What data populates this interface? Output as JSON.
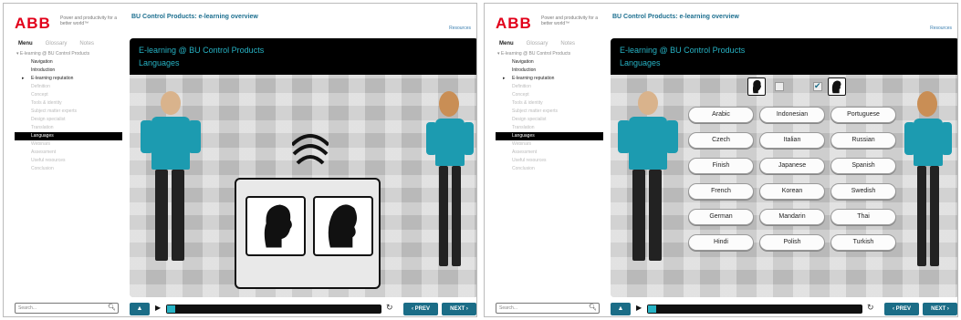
{
  "panels": [
    {
      "header": {
        "logo": "ABB",
        "tagline": "Power and productivity for a better world™",
        "title": "BU Control Products: e-learning overview",
        "resources": "Resources"
      },
      "tabs": [
        "Menu",
        "Glossary",
        "Notes"
      ],
      "course_root": "▾ E-learning @ BU Control Products",
      "menu": [
        {
          "label": "Navigation",
          "state": "done"
        },
        {
          "label": "Introduction",
          "state": "done"
        },
        {
          "label": "E-learning reputation",
          "state": "done-expand"
        },
        {
          "label": "Definition",
          "state": "todo"
        },
        {
          "label": "Concept",
          "state": "todo"
        },
        {
          "label": "Tools & identity",
          "state": "todo"
        },
        {
          "label": "Subject matter experts",
          "state": "todo"
        },
        {
          "label": "Design specialist",
          "state": "todo"
        },
        {
          "label": "Translation",
          "state": "todo"
        },
        {
          "label": "Languages",
          "state": "selected"
        },
        {
          "label": "Webinars",
          "state": "todo"
        },
        {
          "label": "Assessment",
          "state": "todo"
        },
        {
          "label": "Useful resources",
          "state": "todo"
        },
        {
          "label": "Conclusion",
          "state": "todo"
        }
      ],
      "search_placeholder": "Search...",
      "stage": {
        "title": "E-learning @ BU Control Products",
        "subtitle": "Languages"
      },
      "controls": {
        "prev": "‹ PREV",
        "next": "NEXT ›",
        "progress": 0.04
      }
    },
    {
      "header": {
        "logo": "ABB",
        "tagline": "Power and productivity for a better world™",
        "title": "BU Control Products: e-learning overview",
        "resources": "Resources"
      },
      "tabs": [
        "Menu",
        "Glossary",
        "Notes"
      ],
      "course_root": "▾ E-learning @ BU Control Products",
      "menu": [
        {
          "label": "Navigation",
          "state": "done"
        },
        {
          "label": "Introduction",
          "state": "done"
        },
        {
          "label": "E-learning reputation",
          "state": "done-expand"
        },
        {
          "label": "Definition",
          "state": "todo"
        },
        {
          "label": "Concept",
          "state": "todo"
        },
        {
          "label": "Tools & identity",
          "state": "todo"
        },
        {
          "label": "Subject matter experts",
          "state": "todo"
        },
        {
          "label": "Design specialist",
          "state": "todo"
        },
        {
          "label": "Translation",
          "state": "todo"
        },
        {
          "label": "Languages",
          "state": "selected"
        },
        {
          "label": "Webinars",
          "state": "todo"
        },
        {
          "label": "Assessment",
          "state": "todo"
        },
        {
          "label": "Useful resources",
          "state": "todo"
        },
        {
          "label": "Conclusion",
          "state": "todo"
        }
      ],
      "search_placeholder": "Search...",
      "stage": {
        "title": "E-learning @ BU Control Products",
        "subtitle": "Languages",
        "male_checked": false,
        "female_checked": true,
        "languages": [
          "Arabic",
          "Indonesian",
          "Portuguese",
          "Czech",
          "Italian",
          "Russian",
          "Finish",
          "Japanese",
          "Spanish",
          "French",
          "Korean",
          "Swedish",
          "German",
          "Mandarin",
          "Thai",
          "Hindi",
          "Polish",
          "Turkish"
        ]
      },
      "controls": {
        "prev": "‹ PREV",
        "next": "NEXT ›",
        "progress": 0.04
      }
    }
  ],
  "icons": {
    "volume": "volume-icon",
    "play": "play-icon",
    "replay": "replay-icon",
    "search": "search-icon",
    "sound_waves": "sound-waves-icon"
  },
  "colors": {
    "accent": "#27b3c5",
    "button": "#1b6d87",
    "brand_red": "#e2001a",
    "shirt": "#1c9bb0"
  }
}
